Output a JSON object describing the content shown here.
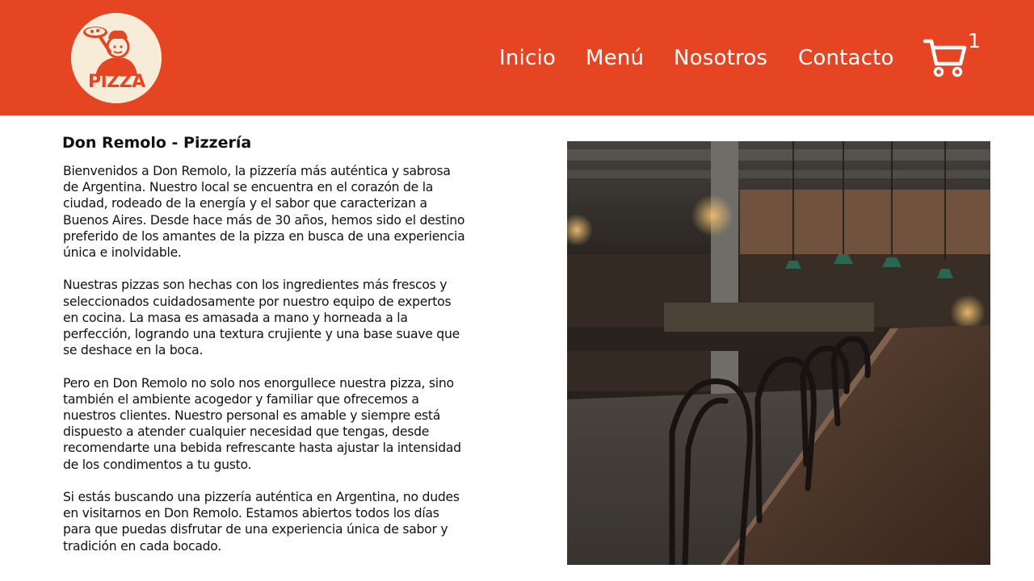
{
  "header": {
    "logo_text": "PIZZA",
    "nav": [
      "Inicio",
      "Menú",
      "Nosotros",
      "Contacto"
    ],
    "cart_count": "1",
    "accent_color": "#e64524"
  },
  "main": {
    "title": "Don Remolo - Pizzería",
    "paragraphs": [
      "Bienvenidos a Don Remolo, la pizzería más auténtica y sabrosa de Argentina. Nuestro local se encuentra en el corazón de la ciudad, rodeado de la energía y el sabor que caracterizan a Buenos Aires. Desde hace más de 30 años, hemos sido el destino preferido de los amantes de la pizza en busca de una experiencia única e inolvidable.",
      "Nuestras pizzas son hechas con los ingredientes más frescos y seleccionados cuidadosamente por nuestro equipo de expertos en cocina. La masa es amasada a mano y horneada a la perfección, logrando una textura crujiente y una base suave que se deshace en la boca.",
      "Pero en Don Remolo no solo nos enorgullece nuestra pizza, sino también el ambiente acogedor y familiar que ofrecemos a nuestros clientes. Nuestro personal es amable y siempre está dispuesto a atender cualquier necesidad que tengas, desde recomendarte una bebida refrescante hasta ajustar la intensidad de los condimentos a tu gusto.",
      "Si estás buscando una pizzería auténtica en Argentina, no dudes en visitarnos en Don Remolo. Estamos abiertos todos los días para que puedas disfrutar de una experiencia única de sabor y tradición en cada bocado."
    ]
  },
  "icons": {
    "logo": "pizza-chef-logo",
    "cart": "shopping-cart-icon",
    "photo": "restaurant-interior-photo"
  }
}
